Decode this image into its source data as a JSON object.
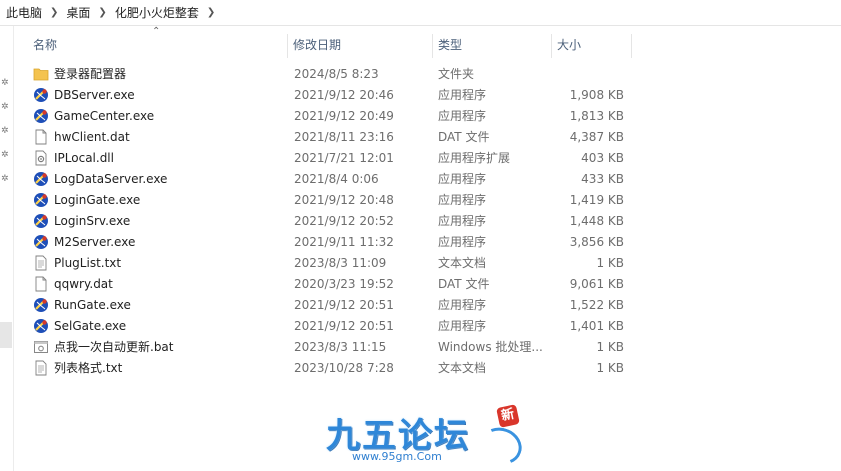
{
  "breadcrumb": [
    "此电脑",
    "桌面",
    "化肥小火炬整套"
  ],
  "columns": {
    "name": "名称",
    "date": "修改日期",
    "type": "类型",
    "size": "大小"
  },
  "files": [
    {
      "name": "登录器配置器",
      "date": "2024/8/5 8:23",
      "type": "文件夹",
      "size": "",
      "icon": "folder-icon"
    },
    {
      "name": "DBServer.exe",
      "date": "2021/9/12 20:46",
      "type": "应用程序",
      "size": "1,908 KB",
      "icon": "exe-icon"
    },
    {
      "name": "GameCenter.exe",
      "date": "2021/9/12 20:49",
      "type": "应用程序",
      "size": "1,813 KB",
      "icon": "exe-icon"
    },
    {
      "name": "hwClient.dat",
      "date": "2021/8/11 23:16",
      "type": "DAT 文件",
      "size": "4,387 KB",
      "icon": "file-icon"
    },
    {
      "name": "IPLocal.dll",
      "date": "2021/7/21 12:01",
      "type": "应用程序扩展",
      "size": "403 KB",
      "icon": "dll-icon"
    },
    {
      "name": "LogDataServer.exe",
      "date": "2021/8/4 0:06",
      "type": "应用程序",
      "size": "433 KB",
      "icon": "exe-icon"
    },
    {
      "name": "LoginGate.exe",
      "date": "2021/9/12 20:48",
      "type": "应用程序",
      "size": "1,419 KB",
      "icon": "exe-icon"
    },
    {
      "name": "LoginSrv.exe",
      "date": "2021/9/12 20:52",
      "type": "应用程序",
      "size": "1,448 KB",
      "icon": "exe-icon"
    },
    {
      "name": "M2Server.exe",
      "date": "2021/9/11 11:32",
      "type": "应用程序",
      "size": "3,856 KB",
      "icon": "exe-icon"
    },
    {
      "name": "PlugList.txt",
      "date": "2023/8/3 11:09",
      "type": "文本文档",
      "size": "1 KB",
      "icon": "txt-icon"
    },
    {
      "name": "qqwry.dat",
      "date": "2020/3/23 19:52",
      "type": "DAT 文件",
      "size": "9,061 KB",
      "icon": "file-icon"
    },
    {
      "name": "RunGate.exe",
      "date": "2021/9/12 20:51",
      "type": "应用程序",
      "size": "1,522 KB",
      "icon": "exe-icon"
    },
    {
      "name": "SelGate.exe",
      "date": "2021/9/12 20:51",
      "type": "应用程序",
      "size": "1,401 KB",
      "icon": "exe-icon"
    },
    {
      "name": "点我一次自动更新.bat",
      "date": "2023/8/3 11:15",
      "type": "Windows 批处理...",
      "size": "1 KB",
      "icon": "bat-icon"
    },
    {
      "name": "列表格式.txt",
      "date": "2023/10/28 7:28",
      "type": "文本文档",
      "size": "1 KB",
      "icon": "txt-icon"
    }
  ],
  "watermark": {
    "title": "九五论坛",
    "url": "www.95gm.Com",
    "seal": "新"
  },
  "colors": {
    "header_text": "#4c607a",
    "folder": "#f4c34f",
    "exe_blue": "#1e4fb8",
    "exe_red": "#d63a2a"
  }
}
